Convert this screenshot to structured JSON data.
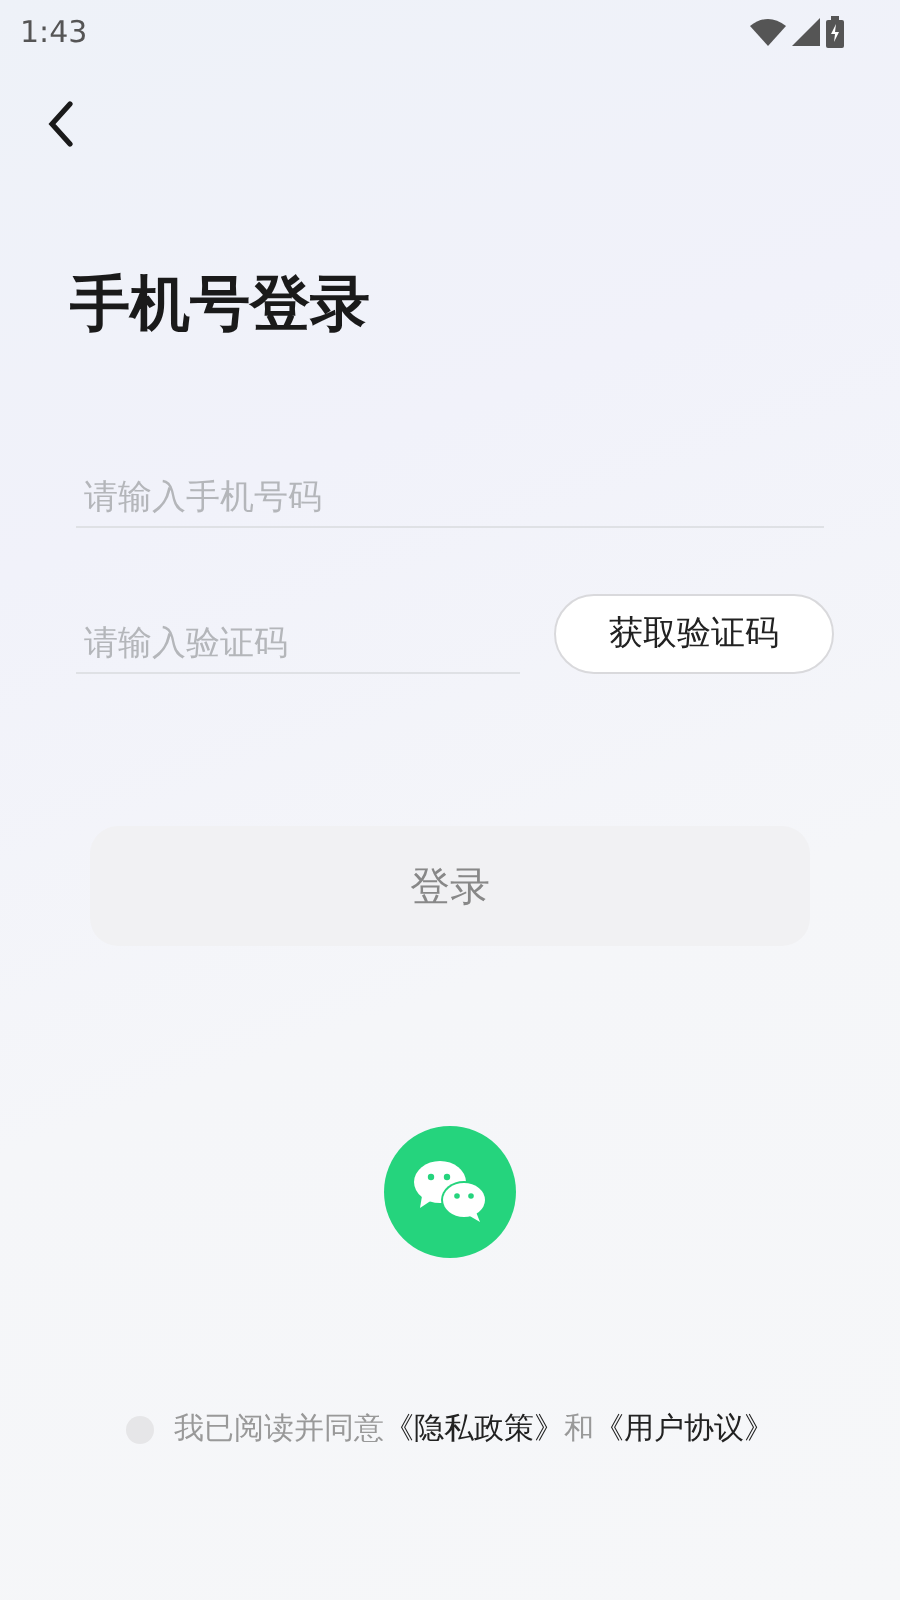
{
  "status_bar": {
    "time": "1:43"
  },
  "title": "手机号登录",
  "phone_field": {
    "placeholder": "请输入手机号码"
  },
  "code_field": {
    "placeholder": "请输入验证码"
  },
  "get_code_button": {
    "label": "获取验证码"
  },
  "login_button": {
    "label": "登录",
    "disabled": true
  },
  "agreement": {
    "checked": false,
    "prefix": "我已阅读并同意",
    "privacy_link": "《隐私政策》",
    "conjunction": "和",
    "terms_link": "《用户协议》"
  }
}
